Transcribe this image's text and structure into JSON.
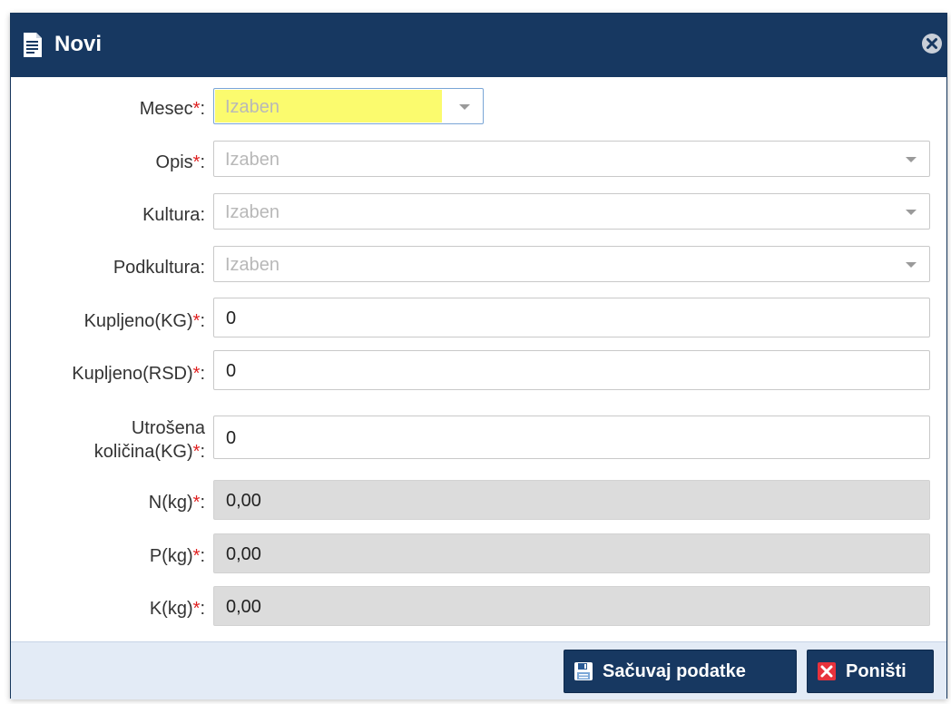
{
  "window": {
    "title": "Novi",
    "title_icon": "document-icon",
    "close_icon": "close-circle-icon"
  },
  "form": {
    "fields": [
      {
        "label": "Mesec",
        "required": "*",
        "colon": ":",
        "type": "select",
        "value": "Izaben"
      },
      {
        "label": "Opis",
        "required": "*",
        "colon": ":",
        "type": "select",
        "value": "Izaben"
      },
      {
        "label": "Kultura",
        "required": "",
        "colon": ":",
        "type": "select",
        "value": "Izaben"
      },
      {
        "label": "Podkultura",
        "required": "",
        "colon": ":",
        "type": "select",
        "value": "Izaben"
      },
      {
        "label": "Kupljeno(KG)",
        "required": "*",
        "colon": ":",
        "type": "number",
        "value": "0"
      },
      {
        "label": "Kupljeno(RSD)",
        "required": "*",
        "colon": ":",
        "type": "number",
        "value": "0"
      },
      {
        "label_line1": "Utrošena",
        "label_line2": "količina(KG)",
        "required": "*",
        "colon": ":",
        "type": "number",
        "value": "0"
      },
      {
        "label": "N(kg)",
        "required": "*",
        "colon": ":",
        "type": "readonly",
        "value": "0,00"
      },
      {
        "label": "P(kg)",
        "required": "*",
        "colon": ":",
        "type": "readonly",
        "value": "0,00"
      },
      {
        "label": "K(kg)",
        "required": "*",
        "colon": ":",
        "type": "readonly",
        "value": "0,00"
      }
    ]
  },
  "footer": {
    "save_label": "Sačuvaj podatke",
    "save_icon": "save-icon",
    "cancel_label": "Poništi",
    "cancel_icon": "cancel-icon"
  },
  "colors": {
    "titlebar": "#173861",
    "required_mark": "#e02020",
    "highlight": "#fbfb6e",
    "readonly_bg": "#dcdcdc"
  }
}
